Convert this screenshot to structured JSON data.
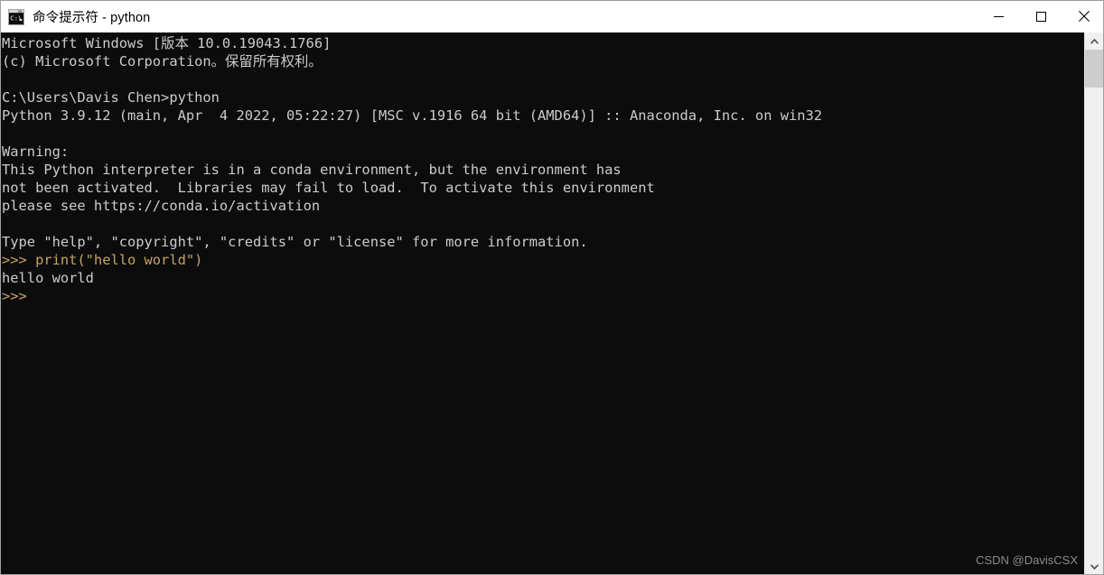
{
  "window": {
    "title": "命令提示符 - python",
    "icon_name": "command-prompt-icon",
    "background_color": "#0c0c0c",
    "titlebar_color": "#ffffff",
    "controls": {
      "minimize_label": "—",
      "maximize_label": "□",
      "close_label": "✕"
    }
  },
  "console": {
    "foreground_color": "#cccccc",
    "prompt_color": "#c8a165",
    "lines": [
      "Microsoft Windows [版本 10.0.19043.1766]",
      "(c) Microsoft Corporation。保留所有权利。",
      "",
      "C:\\Users\\Davis Chen>python",
      "Python 3.9.12 (main, Apr  4 2022, 05:22:27) [MSC v.1916 64 bit (AMD64)] :: Anaconda, Inc. on win32",
      "",
      "Warning:",
      "This Python interpreter is in a conda environment, but the environment has",
      "not been activated.  Libraries may fail to load.  To activate this environment",
      "please see https://conda.io/activation",
      "",
      "Type \"help\", \"copyright\", \"credits\" or \"license\" for more information.",
      ">>> print(\"hello world\")",
      "hello world",
      ">>>"
    ]
  },
  "scrollbar": {
    "up_arrow": "▲",
    "down_arrow": "▼",
    "thumb_name": "scrollbar-thumb"
  },
  "watermark": {
    "text": "CSDN @DavisCSX"
  }
}
